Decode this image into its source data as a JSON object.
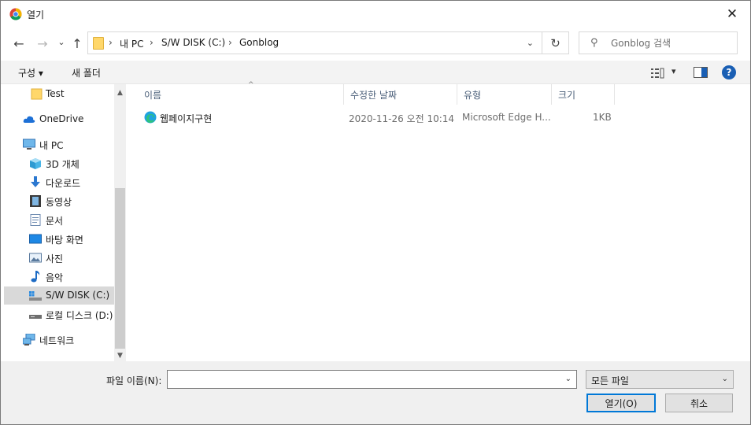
{
  "window": {
    "title": "열기",
    "close_glyph": "✕"
  },
  "nav": {
    "back_glyph": "←",
    "forward_glyph": "→",
    "recent_glyph": "⌄",
    "up_glyph": "↑",
    "refresh_glyph": "↻"
  },
  "address": {
    "crumbs": [
      "내 PC",
      "S/W DISK (C:)",
      "Gonblog"
    ],
    "separator": "›",
    "dropdown_glyph": "⌄"
  },
  "search": {
    "placeholder": "Gonblog 검색",
    "icon_glyph": "⚲"
  },
  "toolbar": {
    "organize": "구성 ▾",
    "new_folder": "새 폴더",
    "view_dd": "▾",
    "help": "?"
  },
  "sidebar": {
    "items": [
      {
        "label": "Test",
        "icon": "folder-icon"
      },
      {
        "label": "OneDrive",
        "icon": "cloud-icon"
      },
      {
        "label": "내 PC",
        "icon": "computer-icon"
      },
      {
        "label": "3D 개체",
        "icon": "cube-icon"
      },
      {
        "label": "다운로드",
        "icon": "download-icon"
      },
      {
        "label": "동영상",
        "icon": "video-icon"
      },
      {
        "label": "문서",
        "icon": "document-icon"
      },
      {
        "label": "바탕 화면",
        "icon": "desktop-icon"
      },
      {
        "label": "사진",
        "icon": "picture-icon"
      },
      {
        "label": "음악",
        "icon": "music-icon"
      },
      {
        "label": "S/W DISK (C:)",
        "icon": "drive-c-icon"
      },
      {
        "label": "로컬 디스크 (D:)",
        "icon": "drive-d-icon"
      },
      {
        "label": "네트워크",
        "icon": "network-icon"
      }
    ],
    "selected": "S/W DISK (C:)",
    "scroll_up": "▲",
    "scroll_down": "▼"
  },
  "columns": {
    "name": "이름",
    "date": "수정한 날짜",
    "type": "유형",
    "size": "크기",
    "sort_glyph": "^"
  },
  "files": [
    {
      "name": "웹페이지구현",
      "date": "2020-11-26 오전 10:14",
      "type": "Microsoft Edge H...",
      "size": "1KB"
    }
  ],
  "bottom": {
    "filename_label": "파일 이름(N):",
    "filename_value": "",
    "filetype": "모든 파일",
    "dropdown_glyph": "⌄",
    "open_label": "열기(O)",
    "cancel_label": "취소"
  }
}
